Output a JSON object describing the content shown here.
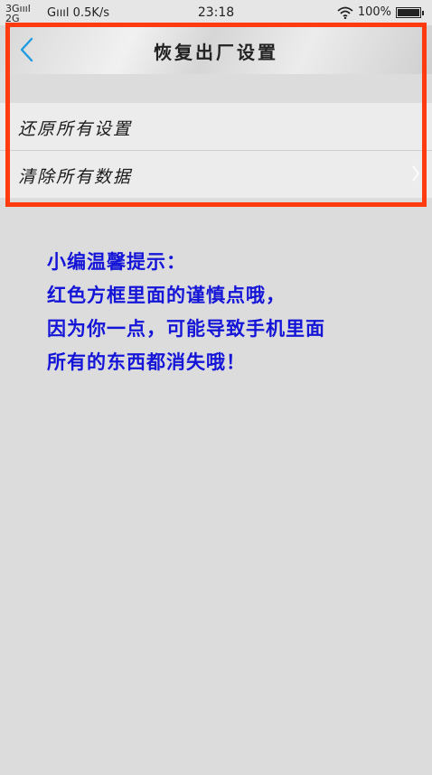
{
  "status_bar": {
    "network_1": "3G",
    "network_2": "2G",
    "network_3": "G",
    "speed": "0.5K/s",
    "time": "23:18",
    "battery": "100%",
    "battery_level": 1.0
  },
  "header": {
    "title": "恢复出厂设置"
  },
  "menu": {
    "items": [
      {
        "label": "还原所有设置"
      },
      {
        "label": "清除所有数据"
      }
    ]
  },
  "tip": {
    "lines": [
      "小编温馨提示：",
      "红色方框里面的谨慎点哦，",
      "因为你一点，可能导致手机里面",
      "所有的东西都消失哦！"
    ]
  },
  "colors": {
    "highlight_border": "#ff3b0f",
    "tip_text": "#1515d8",
    "back_icon": "#1e9be0"
  }
}
